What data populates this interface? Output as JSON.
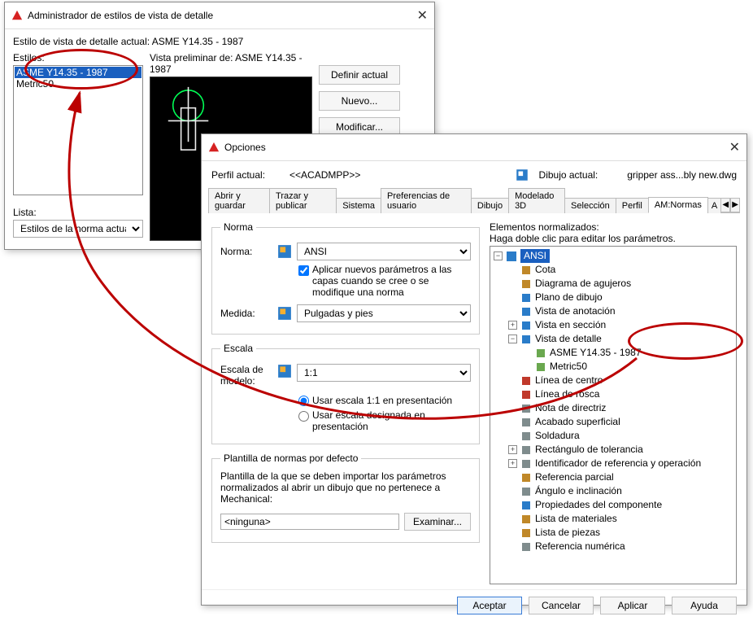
{
  "styleMgr": {
    "title": "Administrador de estilos de vista de detalle",
    "currentLabel": "Estilo de vista de detalle actual: ASME Y14.35 - 1987",
    "stylesLabel": "Estilos:",
    "previewLabel": "Vista preliminar de: ASME Y14.35 - 1987",
    "listLabel": "Lista:",
    "listFilter": "Estilos de la norma actual",
    "items": [
      "ASME Y14.35 - 1987",
      "Metric50"
    ],
    "buttons": {
      "setCurrent": "Definir actual",
      "new": "Nuevo...",
      "modify": "Modificar..."
    }
  },
  "options": {
    "title": "Opciones",
    "profileLabel": "Perfil actual:",
    "profileValue": "<<ACADMPP>>",
    "drawingLabel": "Dibujo actual:",
    "drawingValue": "gripper ass...bly new.dwg",
    "tabs": [
      "Abrir y guardar",
      "Trazar y publicar",
      "Sistema",
      "Preferencias de usuario",
      "Dibujo",
      "Modelado 3D",
      "Selección",
      "Perfil",
      "AM:Normas",
      "A"
    ],
    "activeTab": 8,
    "standard": {
      "legend": "Norma",
      "label": "Norma:",
      "value": "ANSI",
      "applyCheck": "Aplicar nuevos parámetros a las capas cuando se cree o se modifique una norma",
      "measureLabel": "Medida:",
      "measureValue": "Pulgadas y pies"
    },
    "scale": {
      "legend": "Escala",
      "modelLabel": "Escala de modelo:",
      "modelValue": "1:1",
      "radio1": "Usar escala 1:1 en presentación",
      "radio2": "Usar escala designada en presentación"
    },
    "template": {
      "legend": "Plantilla de normas por defecto",
      "desc": "Plantilla de la que se deben importar los parámetros normalizados al abrir un dibujo que no pertenece a Mechanical:",
      "value": "<ninguna>",
      "browse": "Examinar..."
    },
    "stdElements": {
      "header": "Elementos normalizados:",
      "hint": "Haga doble clic para editar los parámetros.",
      "root": "ANSI",
      "detailView": "Vista de detalle",
      "detailChildren": [
        "ASME Y14.35 - 1987",
        "Metric50"
      ],
      "nodes": [
        {
          "label": "Cota",
          "color": "#c08828"
        },
        {
          "label": "Diagrama de agujeros",
          "color": "#c08828"
        },
        {
          "label": "Plano de dibujo",
          "color": "#2a7cc9"
        },
        {
          "label": "Vista de anotación",
          "color": "#2a7cc9"
        },
        {
          "label": "Vista en sección",
          "color": "#2a7cc9",
          "exp": "+"
        },
        {
          "label": "Línea de centro",
          "color": "#c0392b"
        },
        {
          "label": "Línea de rosca",
          "color": "#c0392b"
        },
        {
          "label": "Nota de directriz",
          "color": "#7f8c8d"
        },
        {
          "label": "Acabado superficial",
          "color": "#7f8c8d"
        },
        {
          "label": "Soldadura",
          "color": "#7f8c8d"
        },
        {
          "label": "Rectángulo de tolerancia",
          "color": "#7f8c8d",
          "exp": "+"
        },
        {
          "label": "Identificador de referencia y operación",
          "color": "#7f8c8d",
          "exp": "+"
        },
        {
          "label": "Referencia parcial",
          "color": "#c08828"
        },
        {
          "label": "Ángulo e inclinación",
          "color": "#7f8c8d"
        },
        {
          "label": "Propiedades del componente",
          "color": "#2a7cc9"
        },
        {
          "label": "Lista de materiales",
          "color": "#c08828"
        },
        {
          "label": "Lista de piezas",
          "color": "#c08828"
        },
        {
          "label": "Referencia numérica",
          "color": "#7f8c8d"
        }
      ]
    },
    "footer": {
      "ok": "Aceptar",
      "cancel": "Cancelar",
      "apply": "Aplicar",
      "help": "Ayuda"
    }
  }
}
